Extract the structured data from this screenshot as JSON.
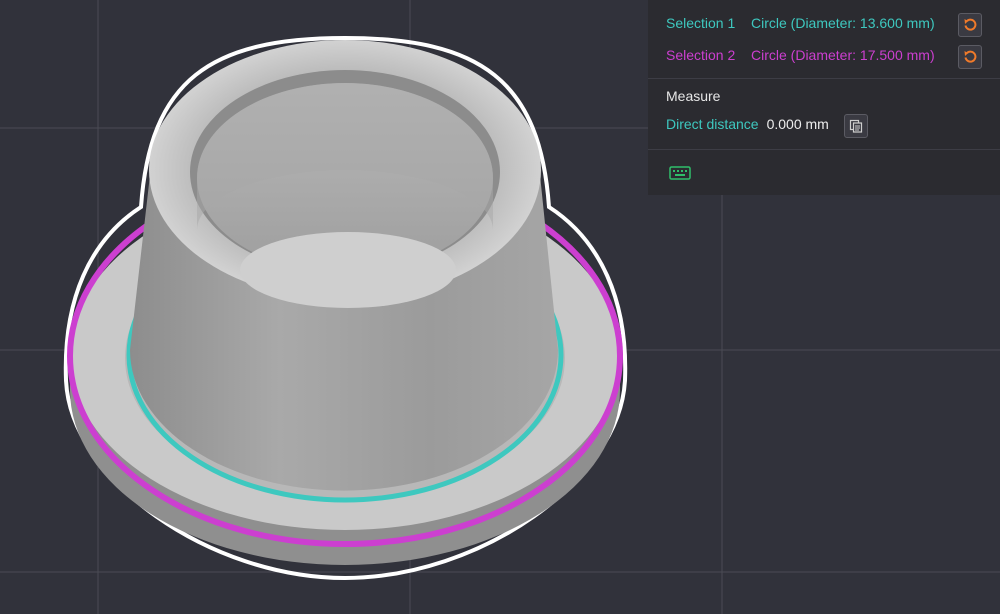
{
  "colors": {
    "background": "#31323b",
    "grid": "#4a4b54",
    "selection1": "#3ec8bf",
    "selection2": "#cc3fd0",
    "reset_accent": "#f07a2a",
    "outline": "#ffffff"
  },
  "selections": [
    {
      "label": "Selection 1",
      "value": "Circle (Diameter: 13.600 mm)",
      "reset_icon": "reset-icon"
    },
    {
      "label": "Selection 2",
      "value": "Circle (Diameter: 17.500 mm)",
      "reset_icon": "reset-icon"
    }
  ],
  "measure": {
    "title": "Measure",
    "direct_distance_label": "Direct distance",
    "direct_distance_value": "0.000 mm",
    "copy_icon": "copy-icon"
  },
  "footer": {
    "keyboard_icon": "keyboard-icon"
  }
}
